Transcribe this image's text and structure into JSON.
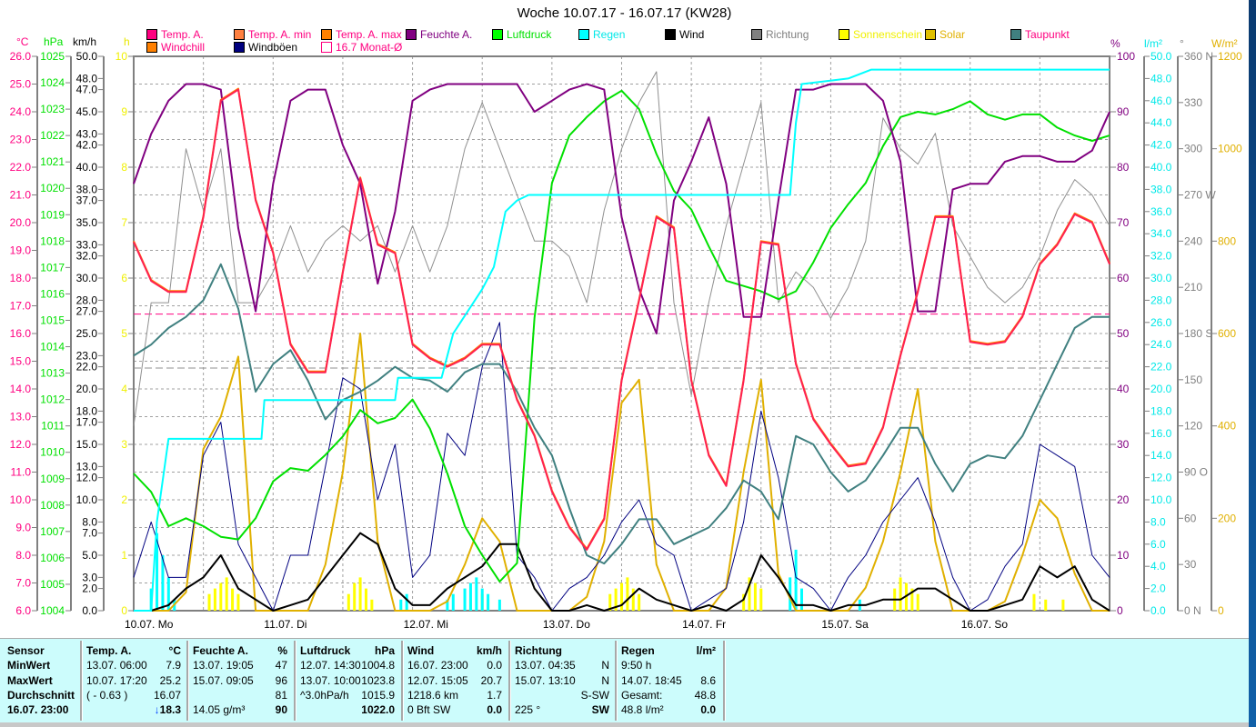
{
  "title": "Woche 10.07.17 - 16.07.17 (KW28)",
  "legend": [
    {
      "label": "Temp. A.",
      "swatch": "#ff0080",
      "text": "#ff0080"
    },
    {
      "label": "Temp. A. min",
      "swatch": "#ff8040",
      "text": "#ff0080"
    },
    {
      "label": "Temp. A. max",
      "swatch": "#ff8000",
      "text": "#ff0080"
    },
    {
      "label": "Feuchte A.",
      "swatch": "#800080",
      "text": "#800080"
    },
    {
      "label": "Luftdruck",
      "swatch": "#00ff00",
      "text": "#00e000"
    },
    {
      "label": "Regen",
      "swatch": "#00ffff",
      "text": "#00e8e8"
    },
    {
      "label": "Wind",
      "swatch": "#000000",
      "text": "#000000"
    },
    {
      "label": "Richtung",
      "swatch": "#808080",
      "text": "#808080"
    },
    {
      "label": "Sonnenschein",
      "swatch": "#ffff00",
      "text": "#f0f000"
    },
    {
      "label": "Solar",
      "swatch": "#e0c000",
      "text": "#e0b000"
    },
    {
      "label": "Taupunkt",
      "swatch": "#408080",
      "text": "#ff0080"
    },
    {
      "label": "Windchill",
      "swatch": "#ff8000",
      "text": "#ff0080"
    },
    {
      "label": "Windböen",
      "swatch": "#000080",
      "text": "#000000"
    },
    {
      "label": "16.7 Monat-Ø",
      "swatch": "#ffffff",
      "text": "#ff0080"
    }
  ],
  "units": {
    "temp": "°C",
    "pressure": "hPa",
    "wind": "km/h",
    "sun": "h",
    "humidity": "%",
    "rain": "l/m²",
    "dir": "°",
    "solar": "W/m²"
  },
  "chart_data": {
    "type": "line",
    "title": "Woche 10.07.17 - 16.07.17 (KW28)",
    "x_unit": "hours since 10.07. 00:00",
    "xlim": [
      0,
      168
    ],
    "day_labels": [
      "10.07.  Mo",
      "11.07.  Di",
      "12.07.  Mi",
      "13.07.  Do",
      "14.07.  Fr",
      "15.07.  Sa",
      "16.07.  So"
    ],
    "grid": true,
    "axes": {
      "temp": {
        "min": 6,
        "max": 26,
        "ticks": [
          "26.0",
          "25.0",
          "24.0",
          "23.0",
          "22.0",
          "21.0",
          "20.0",
          "19.0",
          "18.0",
          "17.0",
          "16.0",
          "15.0",
          "14.0",
          "13.0",
          "12.0",
          "11.0",
          "10.0",
          "9.0",
          "8.0",
          "7.0",
          "6.0"
        ],
        "color": "#ff0080"
      },
      "pressure": {
        "min": 1004,
        "max": 1025,
        "ticks": [
          "1025",
          "1024",
          "1023",
          "1022",
          "1021",
          "1020",
          "1019",
          "1018",
          "1017",
          "1016",
          "1015",
          "1014",
          "1013",
          "1012",
          "1011",
          "1010",
          "1009",
          "1008",
          "1007",
          "1006",
          "1005",
          "1004"
        ],
        "color": "#00e000"
      },
      "wind": {
        "min": 0,
        "max": 50,
        "ticks": [
          "50.0",
          "48.0",
          "47.0",
          "45.0",
          "43.0",
          "42.0",
          "40.0",
          "38.0",
          "37.0",
          "35.0",
          "33.0",
          "32.0",
          "30.0",
          "28.0",
          "27.0",
          "25.0",
          "23.0",
          "22.0",
          "20.0",
          "18.0",
          "17.0",
          "15.0",
          "13.0",
          "12.0",
          "10.0",
          "8.0",
          "7.0",
          "5.0",
          "3.0",
          "2.0",
          "0.0"
        ],
        "color": "#000000"
      },
      "sun": {
        "min": 0,
        "max": 10,
        "ticks": [
          "10",
          "9",
          "8",
          "7",
          "6",
          "5",
          "4",
          "3",
          "2",
          "1",
          "0"
        ],
        "color": "#f0f000"
      },
      "humidity": {
        "min": 0,
        "max": 100,
        "ticks": [
          "100",
          "90",
          "80",
          "70",
          "60",
          "50",
          "40",
          "30",
          "20",
          "10",
          "0"
        ],
        "color": "#800080"
      },
      "rain": {
        "min": 0,
        "max": 50,
        "ticks": [
          "50.0",
          "48.0",
          "46.0",
          "44.0",
          "42.0",
          "40.0",
          "38.0",
          "36.0",
          "34.0",
          "32.0",
          "30.0",
          "28.0",
          "26.0",
          "24.0",
          "22.0",
          "20.0",
          "18.0",
          "16.0",
          "14.0",
          "12.0",
          "10.0",
          "8.0",
          "6.0",
          "4.0",
          "2.0",
          "0.0"
        ],
        "color": "#00e8e8"
      },
      "dir": {
        "min": 0,
        "max": 360,
        "ticks": [
          "360 N",
          "330",
          "300",
          "270 W",
          "240",
          "210",
          "180 S",
          "150",
          "120",
          "90  O",
          "60",
          "30",
          "0   N"
        ],
        "color": "#808080"
      },
      "solar": {
        "min": 0,
        "max": 1200,
        "ticks": [
          "1200",
          "1000",
          "800",
          "600",
          "400",
          "200",
          "0"
        ],
        "color": "#e0b000"
      }
    },
    "month_avg_temp": 16.7,
    "series": [
      {
        "name": "Temp. A.",
        "axis": "temp",
        "color": "#ff2050",
        "step": 3,
        "values": [
          19.3,
          17.9,
          17.5,
          17.5,
          20.2,
          24.4,
          24.8,
          20.8,
          18.9,
          15.6,
          14.6,
          14.6,
          18.2,
          21.6,
          19.2,
          18.9,
          15.6,
          15.1,
          14.8,
          15.1,
          15.6,
          15.6,
          13.6,
          12.3,
          10.3,
          9.0,
          8.2,
          9.3,
          14.3,
          17.2,
          20.2,
          19.8,
          14.3,
          11.6,
          10.5,
          14.3,
          19.3,
          19.2,
          14.9,
          12.9,
          12.0,
          11.2,
          11.3,
          12.6,
          15.2,
          17.5,
          20.2,
          20.2,
          15.7,
          15.6,
          15.7,
          16.6,
          18.5,
          19.2,
          20.3,
          20.0,
          18.5
        ]
      },
      {
        "name": "Feuchte A.",
        "axis": "humidity",
        "color": "#800080",
        "step": 3,
        "values": [
          77,
          86,
          92,
          95,
          95,
          94,
          69,
          54,
          77,
          92,
          94,
          94,
          84,
          77,
          59,
          72,
          92,
          94,
          95,
          95,
          95,
          95,
          95,
          90,
          92,
          94,
          95,
          94,
          71,
          58,
          50,
          74,
          81,
          89,
          77,
          53,
          53,
          74,
          94,
          94,
          95,
          95,
          95,
          92,
          81,
          54,
          54,
          76,
          77,
          77,
          81,
          82,
          82,
          81,
          81,
          83,
          90
        ]
      },
      {
        "name": "Luftdruck",
        "axis": "pressure",
        "color": "#00e000",
        "step": 3,
        "values": [
          1009.2,
          1008.5,
          1007.2,
          1007.5,
          1007.2,
          1006.8,
          1006.7,
          1007.5,
          1008.9,
          1009.4,
          1009.3,
          1009.9,
          1010.6,
          1011.6,
          1011.1,
          1011.3,
          1012.0,
          1010.9,
          1009.2,
          1007.2,
          1006.1,
          1005.1,
          1005.8,
          1015.1,
          1020.2,
          1022.0,
          1022.7,
          1023.3,
          1023.7,
          1023.0,
          1021.3,
          1019.9,
          1019.2,
          1017.8,
          1016.5,
          1016.3,
          1016.1,
          1015.8,
          1016.1,
          1017.2,
          1018.5,
          1019.4,
          1020.2,
          1021.6,
          1022.7,
          1022.9,
          1022.8,
          1023.0,
          1023.3,
          1022.8,
          1022.6,
          1022.8,
          1022.8,
          1022.3,
          1022.0,
          1021.8,
          1022.0
        ]
      },
      {
        "name": "Taupunkt",
        "axis": "temp",
        "color": "#408080",
        "step": 3,
        "values": [
          15.2,
          15.6,
          16.2,
          16.6,
          17.2,
          18.5,
          16.9,
          13.9,
          14.9,
          15.4,
          14.3,
          12.9,
          13.6,
          13.9,
          14.3,
          14.8,
          14.4,
          14.3,
          13.9,
          14.6,
          14.9,
          14.9,
          13.9,
          12.6,
          11.6,
          9.7,
          8.0,
          7.7,
          8.4,
          9.3,
          9.3,
          8.4,
          8.7,
          9.0,
          9.7,
          10.7,
          10.3,
          9.3,
          12.3,
          12.0,
          11.0,
          10.3,
          10.7,
          11.6,
          12.6,
          12.6,
          11.3,
          10.3,
          11.3,
          11.6,
          11.5,
          12.3,
          13.6,
          14.9,
          16.2,
          16.6,
          16.6
        ]
      },
      {
        "name": "Richtung",
        "axis": "dir",
        "color": "#909090",
        "step": 3,
        "values": [
          120,
          200,
          200,
          300,
          260,
          300,
          200,
          200,
          220,
          250,
          220,
          240,
          250,
          240,
          250,
          220,
          250,
          220,
          250,
          300,
          330,
          300,
          270,
          240,
          240,
          230,
          200,
          260,
          300,
          330,
          350,
          200,
          140,
          200,
          250,
          290,
          330,
          200,
          220,
          210,
          190,
          210,
          240,
          320,
          300,
          290,
          310,
          250,
          230,
          210,
          200,
          210,
          230,
          260,
          280,
          270,
          250
        ]
      },
      {
        "name": "Solar",
        "axis": "solar",
        "color": "#e0b000",
        "step": 3,
        "values": [
          0,
          0,
          0,
          40,
          350,
          420,
          550,
          0,
          0,
          0,
          0,
          100,
          300,
          600,
          150,
          0,
          0,
          0,
          20,
          100,
          200,
          150,
          0,
          0,
          0,
          0,
          30,
          150,
          450,
          500,
          100,
          0,
          0,
          0,
          50,
          300,
          500,
          80,
          0,
          0,
          0,
          0,
          50,
          150,
          300,
          480,
          150,
          0,
          0,
          0,
          20,
          120,
          240,
          200,
          80,
          0,
          0
        ]
      },
      {
        "name": "Windböen",
        "axis": "wind",
        "color": "#000080",
        "step": 3,
        "values": [
          3,
          8,
          3,
          3,
          14,
          17,
          6,
          3,
          0,
          5,
          5,
          13,
          21,
          20,
          10,
          15,
          3,
          5,
          16,
          14,
          22,
          26,
          5,
          3,
          0,
          2,
          3,
          5,
          8,
          10,
          6,
          5,
          0,
          1,
          2,
          8,
          18,
          12,
          3,
          2,
          0,
          3,
          5,
          8,
          10,
          12,
          8,
          3,
          0,
          1,
          4,
          6,
          15,
          14,
          13,
          5,
          3
        ]
      },
      {
        "name": "Wind",
        "axis": "wind",
        "color": "#000000",
        "step": 3,
        "values": [
          0,
          0,
          0.5,
          2,
          3,
          5,
          2,
          1,
          0,
          0.5,
          1,
          3,
          5,
          7,
          6,
          2,
          0.5,
          0.5,
          2,
          3,
          4,
          6,
          6,
          2,
          0,
          0,
          0.5,
          0,
          0.5,
          2,
          1,
          0.5,
          0,
          0.5,
          0,
          1,
          5,
          3,
          0.5,
          0.5,
          0,
          0.5,
          0.5,
          1,
          1,
          2,
          2,
          1,
          0,
          0,
          0.5,
          1,
          4,
          3,
          4,
          1,
          0
        ]
      }
    ],
    "rain_total": {
      "axis": "rain",
      "color": "#00ffff",
      "points": [
        [
          0,
          0
        ],
        [
          3,
          0
        ],
        [
          4,
          8
        ],
        [
          6,
          15.5
        ],
        [
          22,
          15.5
        ],
        [
          22.5,
          19
        ],
        [
          45,
          19
        ],
        [
          45.5,
          21
        ],
        [
          53,
          21
        ],
        [
          55,
          25
        ],
        [
          60,
          29
        ],
        [
          62,
          31
        ],
        [
          64,
          36
        ],
        [
          66,
          37
        ],
        [
          68,
          37.5
        ],
        [
          113,
          37.5
        ],
        [
          114,
          44
        ],
        [
          115,
          47.5
        ],
        [
          123,
          48
        ],
        [
          127,
          48.8
        ],
        [
          168,
          48.8
        ]
      ]
    },
    "rain_rate": {
      "axis": "rain",
      "color": "#00ffff",
      "points": [
        [
          3,
          2
        ],
        [
          4,
          7
        ],
        [
          5,
          5
        ],
        [
          6,
          3
        ],
        [
          7,
          1
        ],
        [
          46,
          1
        ],
        [
          47,
          1.5
        ],
        [
          54,
          1
        ],
        [
          55,
          1.5
        ],
        [
          57,
          2
        ],
        [
          58,
          2.5
        ],
        [
          59,
          3
        ],
        [
          60,
          2
        ],
        [
          61,
          1.5
        ],
        [
          63,
          1
        ],
        [
          113,
          3
        ],
        [
          114,
          5.5
        ],
        [
          115,
          2
        ],
        [
          125,
          1
        ]
      ]
    },
    "sunshine": {
      "axis": "sun",
      "color": "#ffff00",
      "points": [
        [
          13,
          0.3
        ],
        [
          14,
          0.4
        ],
        [
          15,
          0.5
        ],
        [
          16,
          0.6
        ],
        [
          17,
          0.4
        ],
        [
          18,
          0.3
        ],
        [
          37,
          0.3
        ],
        [
          38,
          0.5
        ],
        [
          39,
          0.6
        ],
        [
          40,
          0.4
        ],
        [
          41,
          0.2
        ],
        [
          58,
          0.2
        ],
        [
          60,
          0.3
        ],
        [
          61,
          0.2
        ],
        [
          82,
          0.3
        ],
        [
          83,
          0.4
        ],
        [
          84,
          0.5
        ],
        [
          85,
          0.6
        ],
        [
          86,
          0.4
        ],
        [
          87,
          0.3
        ],
        [
          105,
          0.3
        ],
        [
          106,
          0.6
        ],
        [
          107,
          0.5
        ],
        [
          108,
          0.4
        ],
        [
          131,
          0.4
        ],
        [
          132,
          0.6
        ],
        [
          133,
          0.5
        ],
        [
          134,
          0.4
        ],
        [
          135,
          0.3
        ],
        [
          155,
          0.3
        ],
        [
          157,
          0.2
        ],
        [
          160,
          0.2
        ]
      ]
    }
  },
  "table": {
    "sensor": {
      "header": "Sensor",
      "rows": [
        "MinWert",
        "MaxWert",
        "Durchschnitt",
        "16.07. 23:00"
      ]
    },
    "columns": [
      {
        "header": "Temp. A.",
        "unit": "°C",
        "rows": [
          [
            "13.07.  06:00",
            "7.9"
          ],
          [
            "10.07.  17:20",
            "25.2"
          ],
          [
            "( - 0.63 )",
            "16.07"
          ],
          [
            "",
            "18.3"
          ]
        ],
        "trend_icon": "arrow-down"
      },
      {
        "header": "Feuchte A.",
        "unit": "%",
        "rows": [
          [
            "13.07.  19:05",
            "47"
          ],
          [
            "15.07.  09:05",
            "96"
          ],
          [
            "",
            "81"
          ],
          [
            "14.05 g/m³",
            "90"
          ]
        ]
      },
      {
        "header": "Luftdruck",
        "unit": "hPa",
        "rows": [
          [
            "12.07.  14:30",
            "1004.8"
          ],
          [
            "13.07.  10:00",
            "1023.8"
          ],
          [
            "^3.0hPa/h",
            "1015.9"
          ],
          [
            "",
            "1022.0"
          ]
        ]
      },
      {
        "header": "Wind",
        "unit": "km/h",
        "rows": [
          [
            "16.07.  23:00",
            "0.0"
          ],
          [
            "12.07.  15:05",
            "20.7"
          ],
          [
            "1218.6 km",
            "1.7"
          ],
          [
            "0 Bft SW",
            "0.0"
          ]
        ]
      },
      {
        "header": "Richtung",
        "unit": "",
        "rows": [
          [
            "13.07.  04:35",
            "N"
          ],
          [
            "15.07.  13:10",
            "N"
          ],
          [
            "",
            "S-SW"
          ],
          [
            "225 °",
            "SW"
          ]
        ]
      },
      {
        "header": "Regen",
        "unit": "l/m²",
        "rows": [
          [
            "9:50 h",
            ""
          ],
          [
            "14.07.  18:45",
            "8.6"
          ],
          [
            "Gesamt:",
            "48.8"
          ],
          [
            "48.8 l/m²",
            "0.0"
          ]
        ]
      }
    ]
  }
}
